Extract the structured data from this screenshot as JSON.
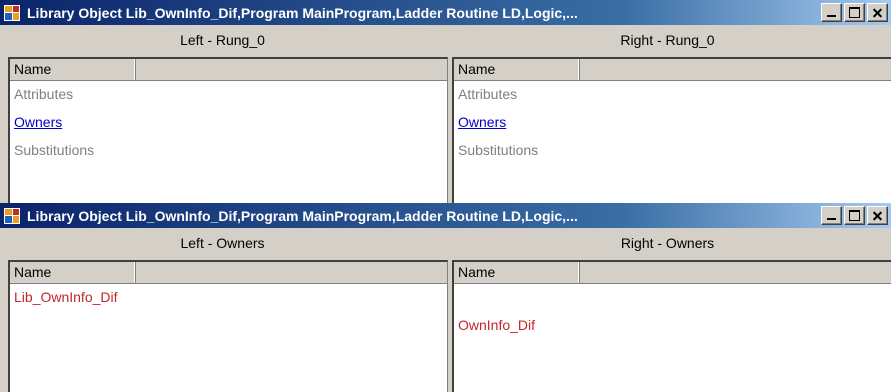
{
  "windows": [
    {
      "title": "Library Object Lib_OwnInfo_Dif,Program MainProgram,Ladder Routine LD,Logic,...",
      "left_header": "Left - Rung_0",
      "right_header": "Right - Rung_0",
      "left_column": "Name",
      "right_column": "Name",
      "left_rows": [
        "Attributes",
        "Owners",
        "Substitutions"
      ],
      "right_rows": [
        "Attributes",
        "Owners",
        "Substitutions"
      ]
    },
    {
      "title": "Library Object Lib_OwnInfo_Dif,Program MainProgram,Ladder Routine LD,Logic,...",
      "left_header": "Left - Owners",
      "right_header": "Right - Owners",
      "left_column": "Name",
      "right_column": "Name",
      "left_rows": [
        "Lib_OwnInfo_Dif"
      ],
      "right_rows": [
        "OwnInfo_Dif"
      ]
    }
  ],
  "colors": {
    "link": "#0000cc",
    "diff": "#c0282a",
    "muted": "#808080"
  }
}
